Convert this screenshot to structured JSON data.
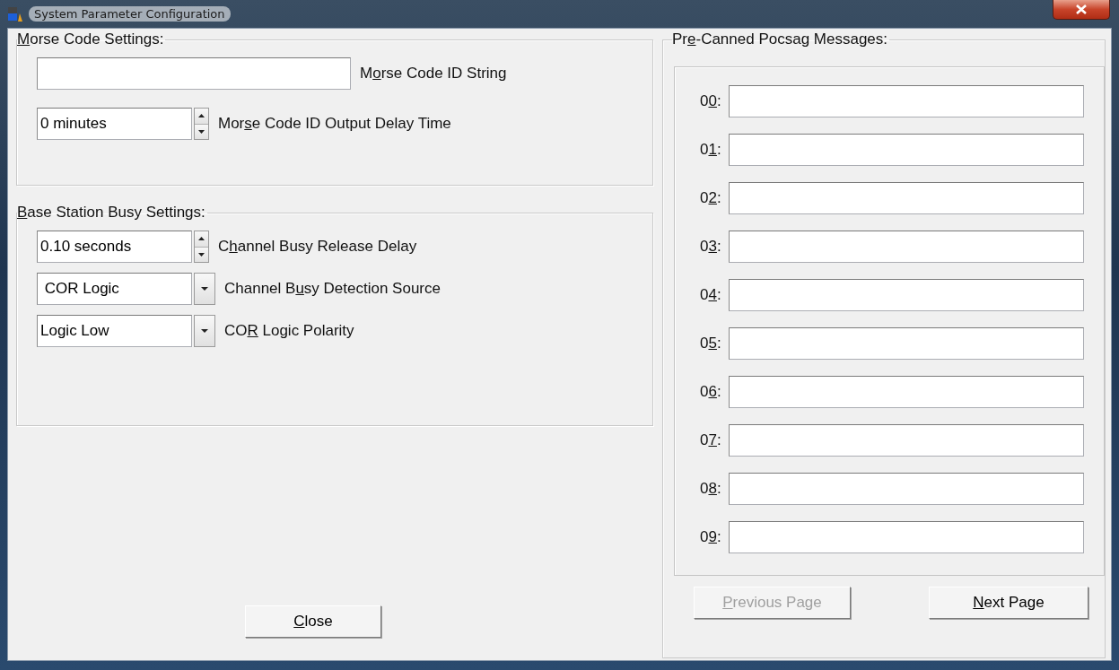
{
  "window": {
    "title": "System Parameter Configuration"
  },
  "morse_code_settings": {
    "legend": {
      "key": "M",
      "post": "orse Code Settings:"
    },
    "controls": [
      {
        "kind": "text",
        "label": {
          "pre": "M",
          "key": "o",
          "post": "rse Code ID String"
        }
      },
      {
        "kind": "spin",
        "value": "0 minutes",
        "label": {
          "pre": "Mor",
          "key": "s",
          "post": "e Code ID Output Delay Time"
        }
      }
    ]
  },
  "base_station_busy_settings": {
    "legend": {
      "key": "B",
      "post": "ase Station Busy Settings:"
    },
    "controls": [
      {
        "kind": "spin",
        "value": "0.10 seconds",
        "label": {
          "pre": "C",
          "key": "h",
          "post": "annel Busy Release Delay"
        }
      },
      {
        "kind": "dropdown",
        "value": " COR Logic",
        "label": {
          "pre": "Channel B",
          "key": "u",
          "post": "sy Detection Source"
        }
      },
      {
        "kind": "dropdown",
        "value": "Logic Low",
        "label": {
          "pre": "CO",
          "key": "R",
          "post": " Logic Polarity"
        }
      }
    ]
  },
  "close_button": {
    "label": {
      "key": "C",
      "post": "lose"
    }
  },
  "pre_canned_pocsag_messages": {
    "legend": {
      "pre": "Pr",
      "key": "e",
      "post": "-Canned Pocsag Messages:"
    },
    "messages": [
      {
        "label": {
          "pre": "0",
          "key": "0",
          "post": ":"
        }
      },
      {
        "label": {
          "pre": "0",
          "key": "1",
          "post": ":"
        }
      },
      {
        "label": {
          "pre": "0",
          "key": "2",
          "post": ":"
        }
      },
      {
        "label": {
          "pre": "0",
          "key": "3",
          "post": ":"
        }
      },
      {
        "label": {
          "pre": "0",
          "key": "4",
          "post": ":"
        }
      },
      {
        "label": {
          "pre": "0",
          "key": "5",
          "post": ":"
        }
      },
      {
        "label": {
          "pre": "0",
          "key": "6",
          "post": ":"
        }
      },
      {
        "label": {
          "pre": "0",
          "key": "7",
          "post": ":"
        }
      },
      {
        "label": {
          "pre": "0",
          "key": "8",
          "post": ":"
        }
      },
      {
        "label": {
          "pre": "0",
          "key": "9",
          "post": ":"
        }
      }
    ],
    "buttons": [
      {
        "label": {
          "key": "P",
          "post": "revious Page"
        },
        "disabled": true
      },
      {
        "label": {
          "key": "N",
          "post": "ext Page"
        },
        "disabled": false
      }
    ]
  }
}
